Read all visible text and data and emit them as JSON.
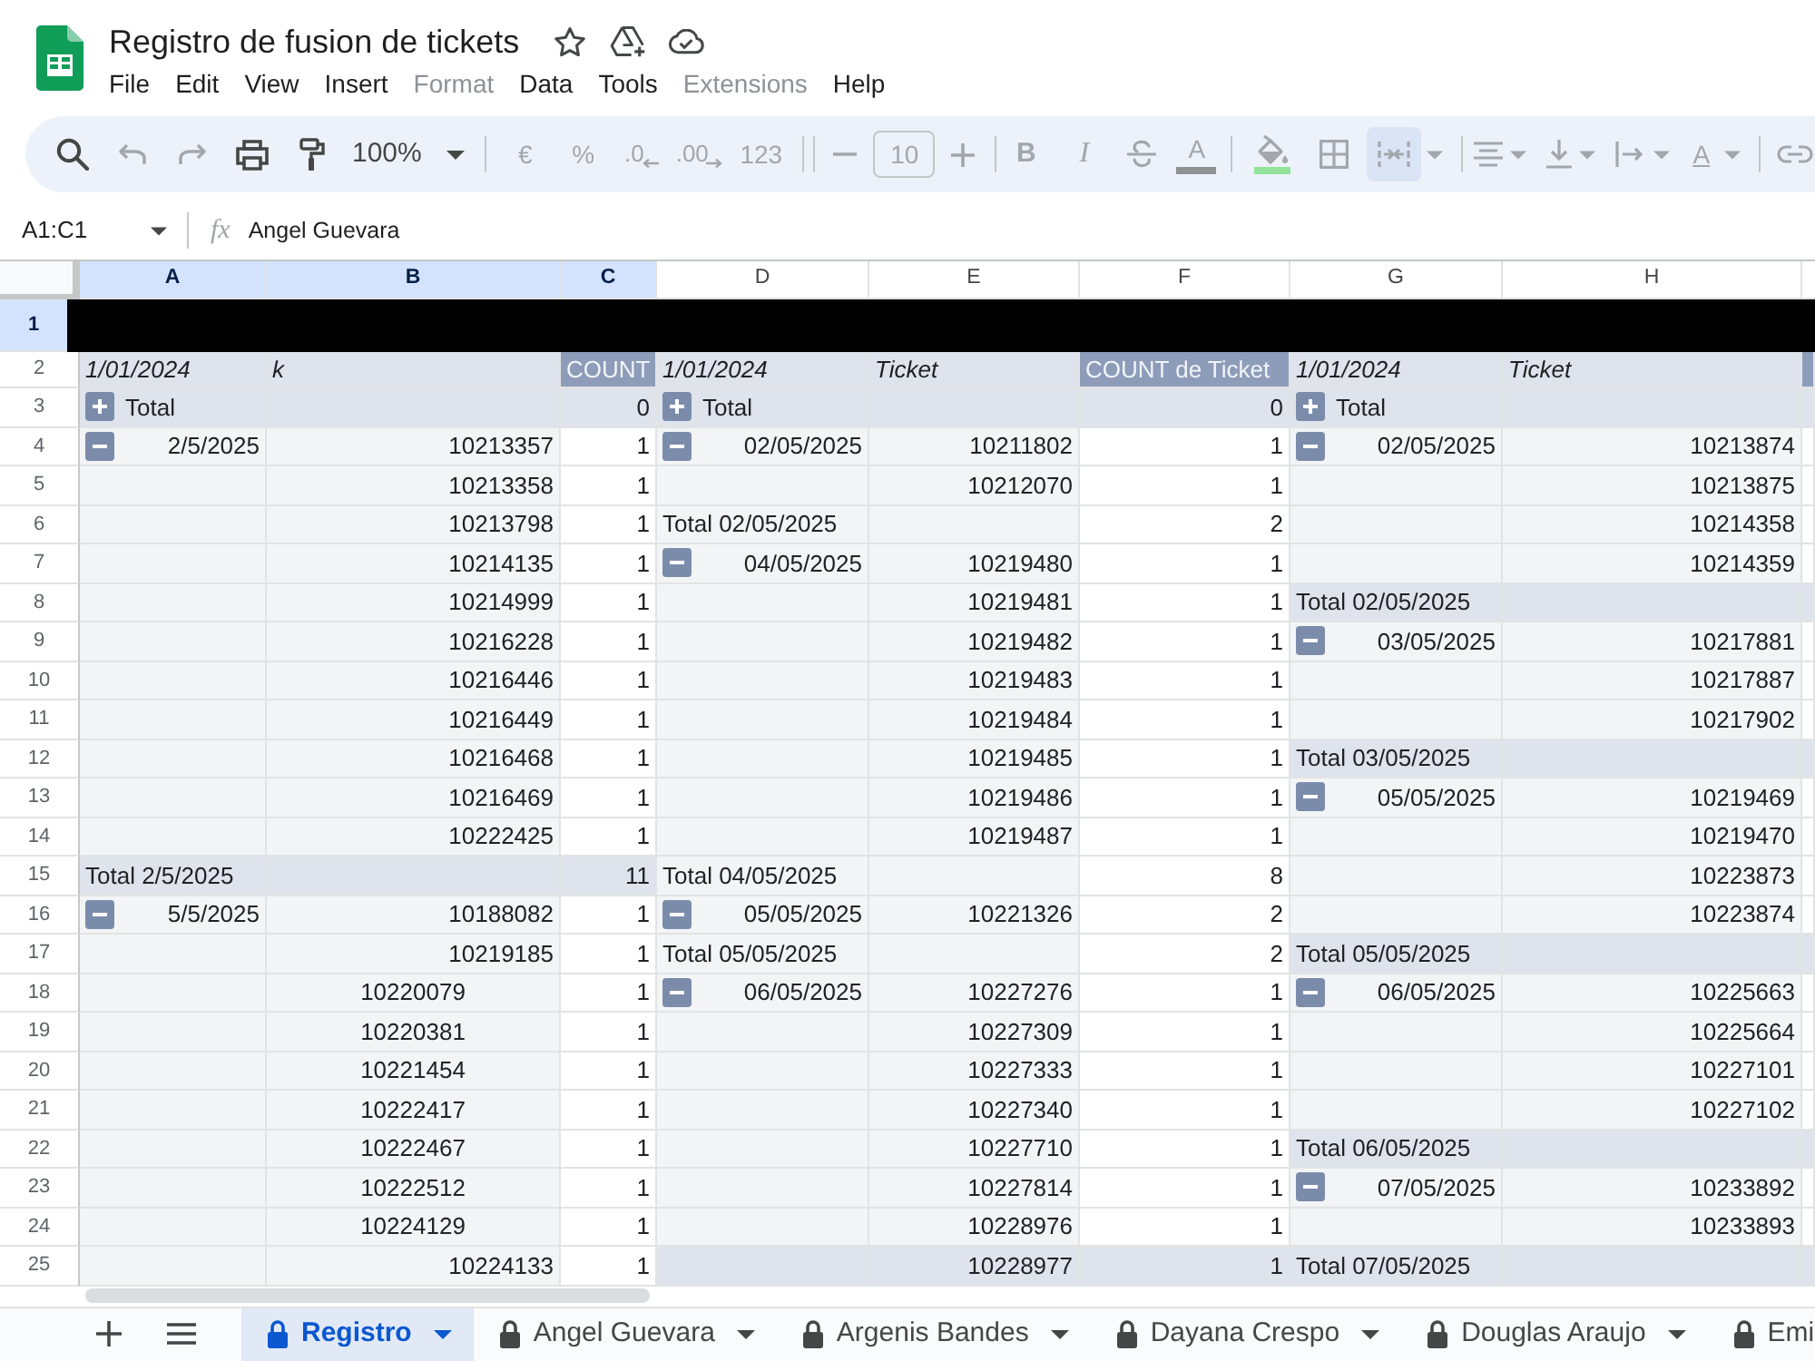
{
  "document": {
    "title": "Registro de fusion de tickets"
  },
  "menu": [
    {
      "label": "File",
      "disabled": false
    },
    {
      "label": "Edit",
      "disabled": false
    },
    {
      "label": "View",
      "disabled": false
    },
    {
      "label": "Insert",
      "disabled": false
    },
    {
      "label": "Format",
      "disabled": true
    },
    {
      "label": "Data",
      "disabled": false
    },
    {
      "label": "Tools",
      "disabled": false
    },
    {
      "label": "Extensions",
      "disabled": true
    },
    {
      "label": "Help",
      "disabled": false
    }
  ],
  "toolbar": {
    "search": {
      "disabled": false
    },
    "undo": {
      "disabled": true
    },
    "redo": {
      "disabled": true
    },
    "print": {
      "disabled": false
    },
    "paint_format": {
      "disabled": false
    },
    "zoom": {
      "label": "100%",
      "disabled": false
    },
    "currency": {
      "label": "€",
      "disabled": true
    },
    "percent": {
      "label": "%",
      "disabled": true
    },
    "decrease_decimal": {
      "label": ".0",
      "disabled": true
    },
    "increase_decimal": {
      "label": ".00",
      "disabled": true
    },
    "number_format": {
      "label": "123",
      "disabled": true
    },
    "font_size_decrease": {
      "disabled": true
    },
    "font_size": {
      "value": "10",
      "disabled": true
    },
    "font_size_increase": {
      "disabled": true
    },
    "bold": {
      "label": "B",
      "disabled": true
    },
    "italic": {
      "label": "I",
      "disabled": true
    },
    "strikethrough": {
      "disabled": true
    },
    "text_color": {
      "label": "A",
      "color": "#8f9193",
      "disabled": true
    },
    "fill_color": {
      "color": "#93e39a",
      "disabled": true
    },
    "borders": {
      "disabled": true
    },
    "merge_cells": {
      "active": true,
      "disabled": true
    },
    "horizontal_align": {
      "disabled": true
    },
    "vertical_align": {
      "disabled": true
    },
    "text_wrap": {
      "disabled": true
    },
    "text_rotation": {
      "label": "A",
      "disabled": true
    },
    "insert_link": {
      "disabled": true
    }
  },
  "formula_bar": {
    "name_box": "A1:C1",
    "function_label": "fx",
    "content": "Angel Guevara"
  },
  "columns": [
    {
      "label": "A",
      "selected": true
    },
    {
      "label": "B",
      "selected": true
    },
    {
      "label": "C",
      "selected": true
    },
    {
      "label": "D",
      "selected": false
    },
    {
      "label": "E",
      "selected": false
    },
    {
      "label": "F",
      "selected": false
    },
    {
      "label": "G",
      "selected": false
    },
    {
      "label": "H",
      "selected": false
    }
  ],
  "rows": [
    {
      "number": "1",
      "selected": true,
      "redacted": true
    },
    {
      "number": "2",
      "selected": false,
      "cells": [
        {
          "kind": "field",
          "text": "1/01/2024",
          "right_aligned": false
        },
        {
          "kind": "field",
          "text": "k",
          "right_aligned": false
        },
        {
          "kind": "measure",
          "text": "COUNT",
          "right_aligned": false
        },
        {
          "kind": "field",
          "text": "1/01/2024",
          "right_aligned": false
        },
        {
          "kind": "field",
          "text": "Ticket",
          "right_aligned": false
        },
        {
          "kind": "measure",
          "text": "COUNT de Ticket",
          "right_aligned": false
        },
        {
          "kind": "field",
          "text": "1/01/2024",
          "right_aligned": false
        },
        {
          "kind": "field",
          "text": "Ticket",
          "right_aligned": false
        },
        {
          "kind": "measure"
        }
      ]
    },
    {
      "number": "3",
      "selected": false,
      "cells": [
        {
          "kind": "shaded",
          "text": "Total",
          "right_aligned": false,
          "toggle": {
            "expanded": false
          }
        },
        {
          "kind": "shaded"
        },
        {
          "kind": "shaded",
          "text": "0",
          "right_aligned": true
        },
        {
          "kind": "shaded",
          "text": "Total",
          "right_aligned": false,
          "toggle": {
            "expanded": false
          }
        },
        {
          "kind": "shaded"
        },
        {
          "kind": "shaded",
          "text": "0",
          "right_aligned": true
        },
        {
          "kind": "shaded",
          "text": "Total",
          "right_aligned": false,
          "toggle": {
            "expanded": false
          }
        },
        {
          "kind": "shaded"
        },
        {
          "kind": "shaded"
        }
      ]
    },
    {
      "number": "4",
      "selected": false,
      "cells": [
        {
          "kind": "label",
          "text": "2/5/2025",
          "right_aligned": true,
          "toggle": {
            "expanded": true
          }
        },
        {
          "kind": "label",
          "text": "10213357",
          "right_aligned": true
        },
        {
          "kind": "value",
          "text": "1",
          "right_aligned": true
        },
        {
          "kind": "label",
          "text": "02/05/2025",
          "right_aligned": true,
          "toggle": {
            "expanded": true
          }
        },
        {
          "kind": "label",
          "text": "10211802",
          "right_aligned": true
        },
        {
          "kind": "value",
          "text": "1",
          "right_aligned": true
        },
        {
          "kind": "label",
          "text": "02/05/2025",
          "right_aligned": true,
          "toggle": {
            "expanded": true
          }
        },
        {
          "kind": "label",
          "text": "10213874",
          "right_aligned": true
        },
        {
          "kind": "value"
        }
      ]
    },
    {
      "number": "5",
      "selected": false,
      "cells": [
        {
          "kind": "label"
        },
        {
          "kind": "label",
          "text": "10213358",
          "right_aligned": true
        },
        {
          "kind": "value",
          "text": "1",
          "right_aligned": true
        },
        {
          "kind": "label"
        },
        {
          "kind": "label",
          "text": "10212070",
          "right_aligned": true
        },
        {
          "kind": "value",
          "text": "1",
          "right_aligned": true
        },
        {
          "kind": "label"
        },
        {
          "kind": "label",
          "text": "10213875",
          "right_aligned": true
        },
        {
          "kind": "value"
        }
      ]
    },
    {
      "number": "6",
      "selected": false,
      "cells": [
        {
          "kind": "label"
        },
        {
          "kind": "label",
          "text": "10213798",
          "right_aligned": true
        },
        {
          "kind": "value",
          "text": "1",
          "right_aligned": true
        },
        {
          "kind": "label",
          "text": "Total 02/05/2025",
          "right_aligned": false
        },
        {
          "kind": "label"
        },
        {
          "kind": "value",
          "text": "2",
          "right_aligned": true
        },
        {
          "kind": "label"
        },
        {
          "kind": "label",
          "text": "10214358",
          "right_aligned": true
        },
        {
          "kind": "value"
        }
      ]
    },
    {
      "number": "7",
      "selected": false,
      "cells": [
        {
          "kind": "label"
        },
        {
          "kind": "label",
          "text": "10214135",
          "right_aligned": true
        },
        {
          "kind": "value",
          "text": "1",
          "right_aligned": true
        },
        {
          "kind": "label",
          "text": "04/05/2025",
          "right_aligned": true,
          "toggle": {
            "expanded": true
          }
        },
        {
          "kind": "label",
          "text": "10219480",
          "right_aligned": true
        },
        {
          "kind": "value",
          "text": "1",
          "right_aligned": true
        },
        {
          "kind": "label"
        },
        {
          "kind": "label",
          "text": "10214359",
          "right_aligned": true
        },
        {
          "kind": "value"
        }
      ]
    },
    {
      "number": "8",
      "selected": false,
      "cells": [
        {
          "kind": "label"
        },
        {
          "kind": "label",
          "text": "10214999",
          "right_aligned": true
        },
        {
          "kind": "value",
          "text": "1",
          "right_aligned": true
        },
        {
          "kind": "label"
        },
        {
          "kind": "label",
          "text": "10219481",
          "right_aligned": true
        },
        {
          "kind": "value",
          "text": "1",
          "right_aligned": true
        },
        {
          "kind": "shaded",
          "text": "Total 02/05/2025",
          "right_aligned": false
        },
        {
          "kind": "shaded"
        },
        {
          "kind": "shaded"
        }
      ]
    },
    {
      "number": "9",
      "selected": false,
      "cells": [
        {
          "kind": "label"
        },
        {
          "kind": "label",
          "text": "10216228",
          "right_aligned": true
        },
        {
          "kind": "value",
          "text": "1",
          "right_aligned": true
        },
        {
          "kind": "label"
        },
        {
          "kind": "label",
          "text": "10219482",
          "right_aligned": true
        },
        {
          "kind": "value",
          "text": "1",
          "right_aligned": true
        },
        {
          "kind": "label",
          "text": "03/05/2025",
          "right_aligned": true,
          "toggle": {
            "expanded": true
          }
        },
        {
          "kind": "label",
          "text": "10217881",
          "right_aligned": true
        },
        {
          "kind": "value"
        }
      ]
    },
    {
      "number": "10",
      "selected": false,
      "cells": [
        {
          "kind": "label"
        },
        {
          "kind": "label",
          "text": "10216446",
          "right_aligned": true
        },
        {
          "kind": "value",
          "text": "1",
          "right_aligned": true
        },
        {
          "kind": "label"
        },
        {
          "kind": "label",
          "text": "10219483",
          "right_aligned": true
        },
        {
          "kind": "value",
          "text": "1",
          "right_aligned": true
        },
        {
          "kind": "label"
        },
        {
          "kind": "label",
          "text": "10217887",
          "right_aligned": true
        },
        {
          "kind": "value"
        }
      ]
    },
    {
      "number": "11",
      "selected": false,
      "cells": [
        {
          "kind": "label"
        },
        {
          "kind": "label",
          "text": "10216449",
          "right_aligned": true
        },
        {
          "kind": "value",
          "text": "1",
          "right_aligned": true
        },
        {
          "kind": "label"
        },
        {
          "kind": "label",
          "text": "10219484",
          "right_aligned": true
        },
        {
          "kind": "value",
          "text": "1",
          "right_aligned": true
        },
        {
          "kind": "label"
        },
        {
          "kind": "label",
          "text": "10217902",
          "right_aligned": true
        },
        {
          "kind": "value"
        }
      ]
    },
    {
      "number": "12",
      "selected": false,
      "cells": [
        {
          "kind": "label"
        },
        {
          "kind": "label",
          "text": "10216468",
          "right_aligned": true
        },
        {
          "kind": "value",
          "text": "1",
          "right_aligned": true
        },
        {
          "kind": "label"
        },
        {
          "kind": "label",
          "text": "10219485",
          "right_aligned": true
        },
        {
          "kind": "value",
          "text": "1",
          "right_aligned": true
        },
        {
          "kind": "shaded",
          "text": "Total 03/05/2025",
          "right_aligned": false
        },
        {
          "kind": "shaded"
        },
        {
          "kind": "shaded"
        }
      ]
    },
    {
      "number": "13",
      "selected": false,
      "cells": [
        {
          "kind": "label"
        },
        {
          "kind": "label",
          "text": "10216469",
          "right_aligned": true
        },
        {
          "kind": "value",
          "text": "1",
          "right_aligned": true
        },
        {
          "kind": "label"
        },
        {
          "kind": "label",
          "text": "10219486",
          "right_aligned": true
        },
        {
          "kind": "value",
          "text": "1",
          "right_aligned": true
        },
        {
          "kind": "label",
          "text": "05/05/2025",
          "right_aligned": true,
          "toggle": {
            "expanded": true
          }
        },
        {
          "kind": "label",
          "text": "10219469",
          "right_aligned": true
        },
        {
          "kind": "value"
        }
      ]
    },
    {
      "number": "14",
      "selected": false,
      "cells": [
        {
          "kind": "label"
        },
        {
          "kind": "label",
          "text": "10222425",
          "right_aligned": true
        },
        {
          "kind": "value",
          "text": "1",
          "right_aligned": true
        },
        {
          "kind": "label"
        },
        {
          "kind": "label",
          "text": "10219487",
          "right_aligned": true
        },
        {
          "kind": "value",
          "text": "1",
          "right_aligned": true
        },
        {
          "kind": "label"
        },
        {
          "kind": "label",
          "text": "10219470",
          "right_aligned": true
        },
        {
          "kind": "value"
        }
      ]
    },
    {
      "number": "15",
      "selected": false,
      "cells": [
        {
          "kind": "shaded",
          "text": "Total 2/5/2025",
          "right_aligned": false
        },
        {
          "kind": "shaded"
        },
        {
          "kind": "shaded",
          "text": "11",
          "right_aligned": true
        },
        {
          "kind": "label",
          "text": "Total 04/05/2025",
          "right_aligned": false
        },
        {
          "kind": "label"
        },
        {
          "kind": "value",
          "text": "8",
          "right_aligned": true
        },
        {
          "kind": "label"
        },
        {
          "kind": "label",
          "text": "10223873",
          "right_aligned": true
        },
        {
          "kind": "value"
        }
      ]
    },
    {
      "number": "16",
      "selected": false,
      "cells": [
        {
          "kind": "label",
          "text": "5/5/2025",
          "right_aligned": true,
          "toggle": {
            "expanded": true
          }
        },
        {
          "kind": "label",
          "text": "10188082",
          "right_aligned": true
        },
        {
          "kind": "value",
          "text": "1",
          "right_aligned": true
        },
        {
          "kind": "label",
          "text": "05/05/2025",
          "right_aligned": true,
          "toggle": {
            "expanded": true
          }
        },
        {
          "kind": "label",
          "text": "10221326",
          "right_aligned": true
        },
        {
          "kind": "value",
          "text": "2",
          "right_aligned": true
        },
        {
          "kind": "label"
        },
        {
          "kind": "label",
          "text": "10223874",
          "right_aligned": true
        },
        {
          "kind": "value"
        }
      ]
    },
    {
      "number": "17",
      "selected": false,
      "cells": [
        {
          "kind": "label"
        },
        {
          "kind": "label",
          "text": "10219185",
          "right_aligned": true
        },
        {
          "kind": "value",
          "text": "1",
          "right_aligned": true
        },
        {
          "kind": "label",
          "text": "Total 05/05/2025",
          "right_aligned": false
        },
        {
          "kind": "label"
        },
        {
          "kind": "value",
          "text": "2",
          "right_aligned": true
        },
        {
          "kind": "shaded",
          "text": "Total 05/05/2025",
          "right_aligned": false
        },
        {
          "kind": "shaded"
        },
        {
          "kind": "shaded"
        }
      ]
    },
    {
      "number": "18",
      "selected": false,
      "cells": [
        {
          "kind": "label"
        },
        {
          "kind": "label",
          "text": "10220079",
          "right_aligned": false,
          "centered": true
        },
        {
          "kind": "value",
          "text": "1",
          "right_aligned": true
        },
        {
          "kind": "label",
          "text": "06/05/2025",
          "right_aligned": true,
          "toggle": {
            "expanded": true
          }
        },
        {
          "kind": "label",
          "text": "10227276",
          "right_aligned": true
        },
        {
          "kind": "value",
          "text": "1",
          "right_aligned": true
        },
        {
          "kind": "label",
          "text": "06/05/2025",
          "right_aligned": true,
          "toggle": {
            "expanded": true
          }
        },
        {
          "kind": "label",
          "text": "10225663",
          "right_aligned": true
        },
        {
          "kind": "value"
        }
      ]
    },
    {
      "number": "19",
      "selected": false,
      "cells": [
        {
          "kind": "label"
        },
        {
          "kind": "label",
          "text": "10220381",
          "right_aligned": false,
          "centered": true
        },
        {
          "kind": "value",
          "text": "1",
          "right_aligned": true
        },
        {
          "kind": "label"
        },
        {
          "kind": "label",
          "text": "10227309",
          "right_aligned": true
        },
        {
          "kind": "value",
          "text": "1",
          "right_aligned": true
        },
        {
          "kind": "label"
        },
        {
          "kind": "label",
          "text": "10225664",
          "right_aligned": true
        },
        {
          "kind": "value"
        }
      ]
    },
    {
      "number": "20",
      "selected": false,
      "cells": [
        {
          "kind": "label"
        },
        {
          "kind": "label",
          "text": "10221454",
          "right_aligned": false,
          "centered": true
        },
        {
          "kind": "value",
          "text": "1",
          "right_aligned": true
        },
        {
          "kind": "label"
        },
        {
          "kind": "label",
          "text": "10227333",
          "right_aligned": true
        },
        {
          "kind": "value",
          "text": "1",
          "right_aligned": true
        },
        {
          "kind": "label"
        },
        {
          "kind": "label",
          "text": "10227101",
          "right_aligned": true
        },
        {
          "kind": "value"
        }
      ]
    },
    {
      "number": "21",
      "selected": false,
      "cells": [
        {
          "kind": "label"
        },
        {
          "kind": "label",
          "text": "10222417",
          "right_aligned": false,
          "centered": true
        },
        {
          "kind": "value",
          "text": "1",
          "right_aligned": true
        },
        {
          "kind": "label"
        },
        {
          "kind": "label",
          "text": "10227340",
          "right_aligned": true
        },
        {
          "kind": "value",
          "text": "1",
          "right_aligned": true
        },
        {
          "kind": "label"
        },
        {
          "kind": "label",
          "text": "10227102",
          "right_aligned": true
        },
        {
          "kind": "value"
        }
      ]
    },
    {
      "number": "22",
      "selected": false,
      "cells": [
        {
          "kind": "label"
        },
        {
          "kind": "label",
          "text": "10222467",
          "right_aligned": false,
          "centered": true
        },
        {
          "kind": "value",
          "text": "1",
          "right_aligned": true
        },
        {
          "kind": "label"
        },
        {
          "kind": "label",
          "text": "10227710",
          "right_aligned": true
        },
        {
          "kind": "value",
          "text": "1",
          "right_aligned": true
        },
        {
          "kind": "shaded",
          "text": "Total 06/05/2025",
          "right_aligned": false
        },
        {
          "kind": "shaded"
        },
        {
          "kind": "shaded"
        }
      ]
    },
    {
      "number": "23",
      "selected": false,
      "cells": [
        {
          "kind": "label"
        },
        {
          "kind": "label",
          "text": "10222512",
          "right_aligned": false,
          "centered": true
        },
        {
          "kind": "value",
          "text": "1",
          "right_aligned": true
        },
        {
          "kind": "label"
        },
        {
          "kind": "label",
          "text": "10227814",
          "right_aligned": true
        },
        {
          "kind": "value",
          "text": "1",
          "right_aligned": true
        },
        {
          "kind": "label",
          "text": "07/05/2025",
          "right_aligned": true,
          "toggle": {
            "expanded": true
          }
        },
        {
          "kind": "label",
          "text": "10233892",
          "right_aligned": true
        },
        {
          "kind": "value"
        }
      ]
    },
    {
      "number": "24",
      "selected": false,
      "cells": [
        {
          "kind": "label"
        },
        {
          "kind": "label",
          "text": "10224129",
          "right_aligned": false,
          "centered": true
        },
        {
          "kind": "value",
          "text": "1",
          "right_aligned": true
        },
        {
          "kind": "label"
        },
        {
          "kind": "label",
          "text": "10228976",
          "right_aligned": true
        },
        {
          "kind": "value",
          "text": "1",
          "right_aligned": true
        },
        {
          "kind": "label"
        },
        {
          "kind": "label",
          "text": "10233893",
          "right_aligned": true
        },
        {
          "kind": "value"
        }
      ]
    },
    {
      "number": "25",
      "selected": false,
      "cells": [
        {
          "kind": "label"
        },
        {
          "kind": "label",
          "text": "10224133",
          "right_aligned": true
        },
        {
          "kind": "value",
          "text": "1",
          "right_aligned": true
        },
        {
          "kind": "shaded"
        },
        {
          "kind": "shaded",
          "text": "10228977",
          "right_aligned": true
        },
        {
          "kind": "shaded",
          "text": "1",
          "right_aligned": true
        },
        {
          "kind": "shaded",
          "text": "Total 07/05/2025",
          "right_aligned": false
        },
        {
          "kind": "shaded"
        },
        {
          "kind": "shaded"
        }
      ]
    }
  ],
  "sheet_tabs": [
    {
      "label": "Registro",
      "selected": true,
      "locked": true
    },
    {
      "label": "Angel Guevara",
      "selected": false,
      "locked": true
    },
    {
      "label": "Argenis Bandes",
      "selected": false,
      "locked": true
    },
    {
      "label": "Dayana Crespo",
      "selected": false,
      "locked": true
    },
    {
      "label": "Douglas Araujo",
      "selected": false,
      "locked": true
    },
    {
      "label": "Emi",
      "selected": false,
      "locked": true
    }
  ]
}
